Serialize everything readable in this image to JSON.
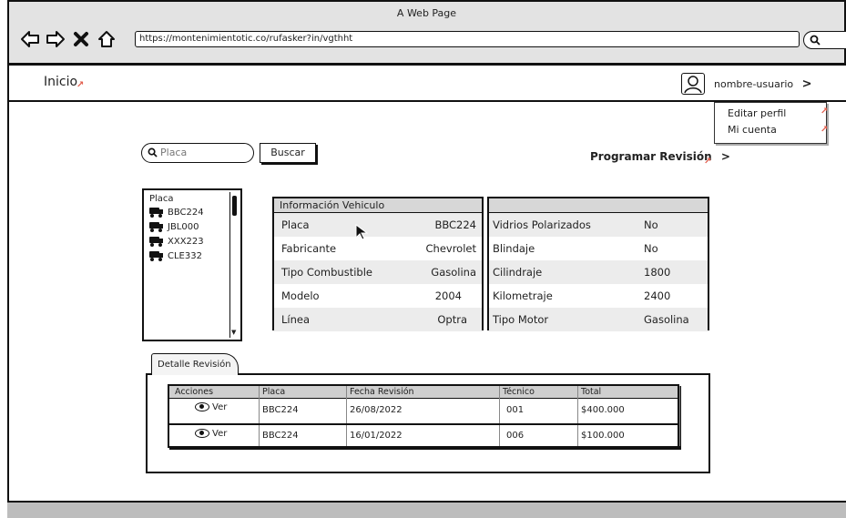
{
  "browser": {
    "title": "A Web Page",
    "url": "https://montenimientotic.co/rufasker?in/vgthht"
  },
  "header": {
    "home_label": "Inicio",
    "username": "nombre-usuario",
    "user_menu": [
      "Editar perfil",
      "Mi cuenta"
    ]
  },
  "search": {
    "placeholder": "Placa",
    "button_label": "Buscar"
  },
  "schedule_link": "Programar Revisión",
  "plate_list": {
    "title": "Placa",
    "items": [
      "BBC224",
      "JBL000",
      "XXX223",
      "CLE332"
    ]
  },
  "vehicle_info": {
    "title": "Información Vehiculo",
    "left_rows": [
      {
        "label": "Placa",
        "value": "BBC224"
      },
      {
        "label": "Fabricante",
        "value": "Chevrolet"
      },
      {
        "label": "Tipo Combustible",
        "value": "Gasolina"
      },
      {
        "label": "Modelo",
        "value": "2004"
      },
      {
        "label": "Línea",
        "value": "Optra"
      }
    ],
    "right_rows": [
      {
        "label": "Vidrios Polarizados",
        "value": "No"
      },
      {
        "label": "Blindaje",
        "value": "No"
      },
      {
        "label": "Cilindraje",
        "value": "1800"
      },
      {
        "label": "Kilometraje",
        "value": "2400"
      },
      {
        "label": "Tipo Motor",
        "value": "Gasolina"
      }
    ]
  },
  "detail": {
    "tab_label": "Detalle Revisión",
    "columns": [
      "Acciones",
      "Placa",
      "Fecha Revisión",
      "Técnico",
      "Total"
    ],
    "rows": [
      {
        "action": "Ver",
        "placa": "BBC224",
        "fecha": "26/08/2022",
        "tecnico": "001",
        "total": "$400.000"
      },
      {
        "action": "Ver",
        "placa": "BBC224",
        "fecha": "16/01/2022",
        "tecnico": "006",
        "total": "$100.000"
      }
    ]
  },
  "icons": {
    "back": "arrow-left-icon",
    "forward": "arrow-right-icon",
    "close": "close-icon",
    "home": "home-icon",
    "search": "search-icon",
    "avatar": "user-icon",
    "chevron": "chevron-right-icon",
    "vehicle": "truck-icon",
    "view": "eye-icon"
  },
  "colors": {
    "link_marker": "#e15b4a",
    "header_gray": "#d7d7d7"
  }
}
